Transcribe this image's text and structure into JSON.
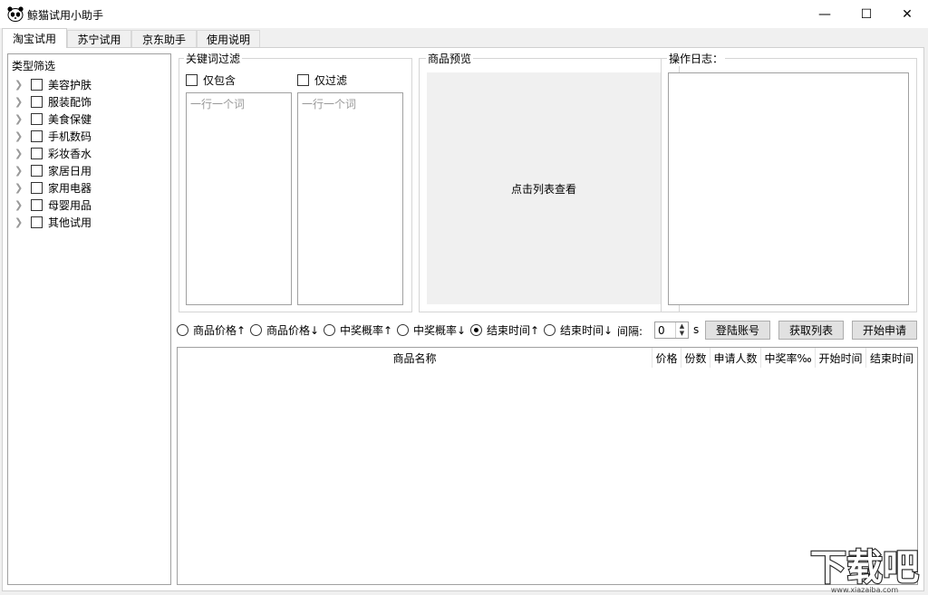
{
  "window": {
    "title": "鲸猫试用小助手",
    "controls": {
      "minimize": "—",
      "maximize": "☐",
      "close": "✕"
    }
  },
  "tabs": [
    {
      "label": "淘宝试用",
      "active": true
    },
    {
      "label": "苏宁试用",
      "active": false
    },
    {
      "label": "京东助手",
      "active": false
    },
    {
      "label": "使用说明",
      "active": false
    }
  ],
  "category_panel": {
    "title": "类型筛选",
    "items": [
      "美容护肤",
      "服装配饰",
      "美食保健",
      "手机数码",
      "彩妆香水",
      "家居日用",
      "家用电器",
      "母婴用品",
      "其他试用"
    ]
  },
  "keyword_filter": {
    "title": "关键词过滤",
    "include_only": {
      "label": "仅包含",
      "checked": false,
      "placeholder": "一行一个词"
    },
    "filter_only": {
      "label": "仅过滤",
      "checked": false,
      "placeholder": "一行一个词"
    }
  },
  "preview": {
    "title": "商品预览",
    "hint": "点击列表查看"
  },
  "log": {
    "title": "操作日志："
  },
  "sort_options": [
    {
      "label": "商品价格↑",
      "checked": false
    },
    {
      "label": "商品价格↓",
      "checked": false
    },
    {
      "label": "中奖概率↑",
      "checked": false
    },
    {
      "label": "中奖概率↓",
      "checked": false
    },
    {
      "label": "结束时间↑",
      "checked": true
    },
    {
      "label": "结束时间↓",
      "checked": false
    }
  ],
  "interval": {
    "label": "间隔:",
    "value": "0",
    "unit": "s"
  },
  "buttons": {
    "login": "登陆账号",
    "fetch": "获取列表",
    "start": "开始申请"
  },
  "table": {
    "columns": [
      "商品名称",
      "价格",
      "份数",
      "申请人数",
      "中奖率‰",
      "开始时间",
      "结束时间"
    ]
  },
  "watermark": {
    "text": "下载吧",
    "url": "www.xiazaiba.com"
  }
}
